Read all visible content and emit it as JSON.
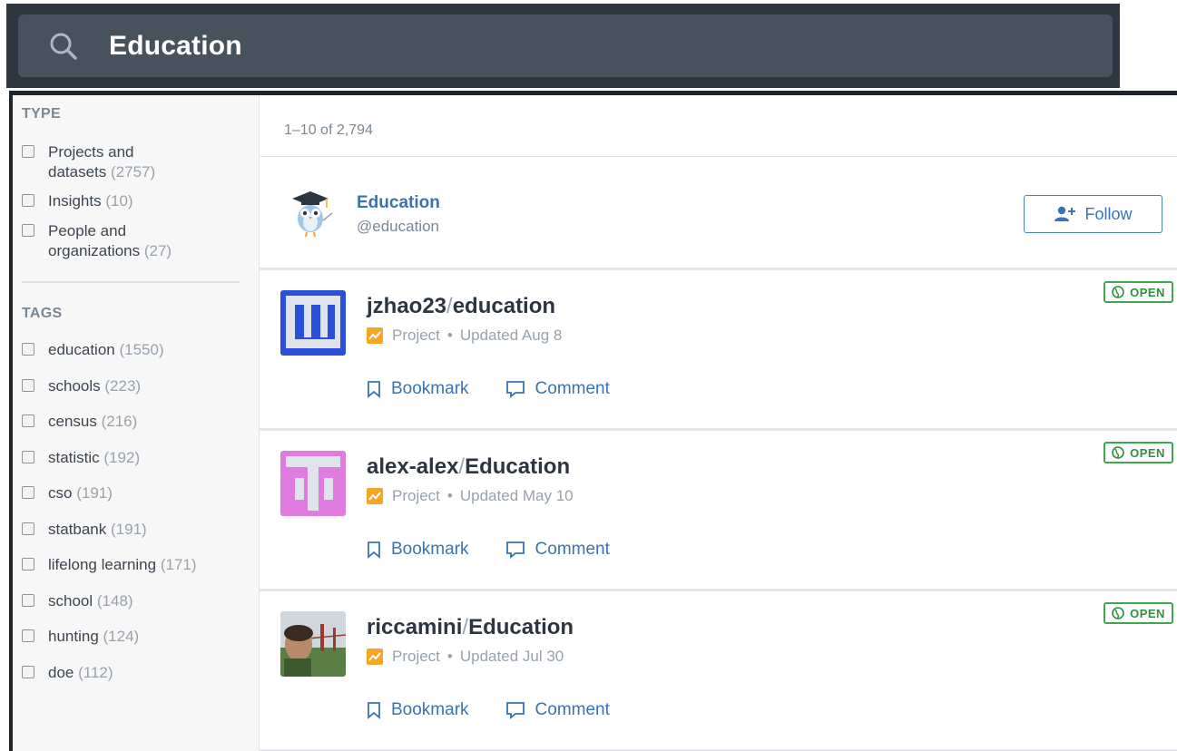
{
  "search": {
    "query": "Education"
  },
  "sidebar": {
    "type_title": "TYPE",
    "type_filters": [
      {
        "label": "Projects and datasets",
        "count": "(2757)"
      },
      {
        "label": "Insights",
        "count": "(10)"
      },
      {
        "label": "People and organizations",
        "count": "(27)"
      }
    ],
    "tags_title": "TAGS",
    "tag_filters": [
      {
        "label": "education",
        "count": "(1550)"
      },
      {
        "label": "schools",
        "count": "(223)"
      },
      {
        "label": "census",
        "count": "(216)"
      },
      {
        "label": "statistic",
        "count": "(192)"
      },
      {
        "label": "cso",
        "count": "(191)"
      },
      {
        "label": "statbank",
        "count": "(191)"
      },
      {
        "label": "lifelong learning",
        "count": "(171)"
      },
      {
        "label": "school",
        "count": "(148)"
      },
      {
        "label": "hunting",
        "count": "(124)"
      },
      {
        "label": "doe",
        "count": "(112)"
      }
    ]
  },
  "results": {
    "count_text": "1–10 of 2,794",
    "account": {
      "name": "Education",
      "handle": "@education",
      "follow_label": "Follow"
    },
    "projects": [
      {
        "owner": "jzhao23",
        "slash": "/",
        "name": "education",
        "type": "Project",
        "dot": "•",
        "updated": "Updated Aug 8",
        "badge": "OPEN",
        "bookmark": "Bookmark",
        "comment": "Comment",
        "thumb": "blue-blocks"
      },
      {
        "owner": "alex-alex",
        "slash": "/",
        "name": "Education",
        "type": "Project",
        "dot": "•",
        "updated": "Updated May 10",
        "badge": "OPEN",
        "bookmark": "Bookmark",
        "comment": "Comment",
        "thumb": "pink-blocks"
      },
      {
        "owner": "riccamini",
        "slash": "/",
        "name": "Education",
        "type": "Project",
        "dot": "•",
        "updated": "Updated Jul 30",
        "badge": "OPEN",
        "bookmark": "Bookmark",
        "comment": "Comment",
        "thumb": "photo"
      }
    ]
  },
  "colors": {
    "link": "#3a73b5",
    "open_green": "#3ea84a",
    "project_orange": "#f5a623",
    "thumb_blue": "#2a4fd8",
    "thumb_pink": "#e07be0"
  }
}
